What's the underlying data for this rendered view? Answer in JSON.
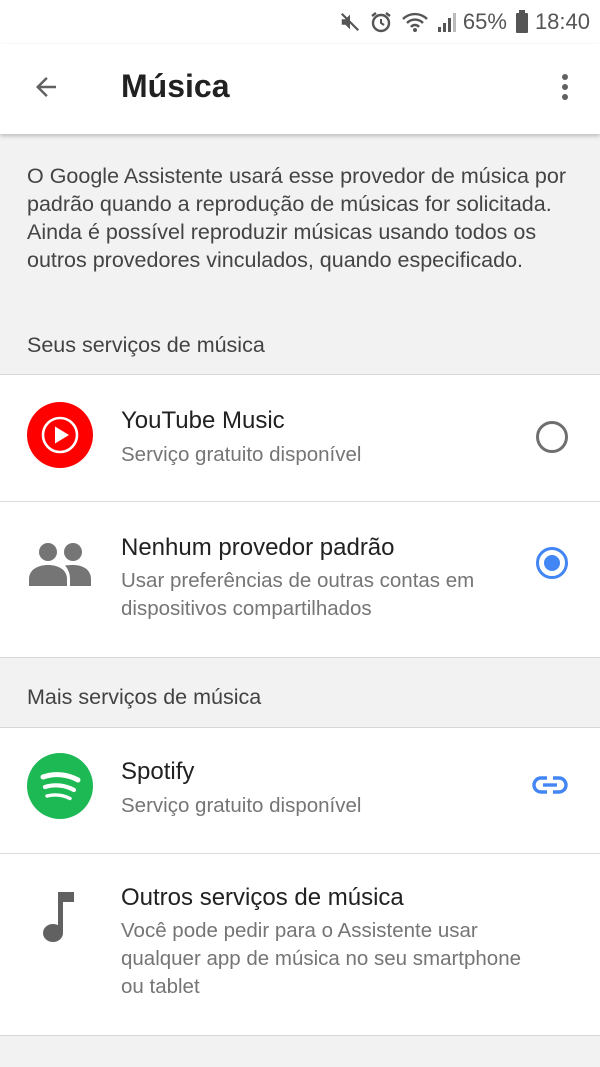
{
  "status_bar": {
    "battery": "65%",
    "time": "18:40",
    "icons": [
      "mute-icon",
      "alarm-icon",
      "wifi-icon",
      "signal-icon",
      "battery-icon"
    ]
  },
  "app_bar": {
    "title": "Música",
    "back_icon": "arrow-left-icon",
    "menu_icon": "more-vert-icon"
  },
  "description": "O Google Assistente usará esse provedor de música por padrão quando a reprodução de músicas for solicitada. Ainda é possível reproduzir músicas usando todos os outros provedores vinculados, quando especificado.",
  "sections": [
    {
      "header": "Seus serviços de música",
      "items": [
        {
          "title": "YouTube Music",
          "subtitle": "Serviço gratuito disponível",
          "icon": "youtube-music-icon",
          "action": "radio",
          "selected": false
        },
        {
          "title": "Nenhum provedor padrão",
          "subtitle": "Usar preferências de outras contas em dispositivos compartilhados",
          "icon": "people-icon",
          "action": "radio",
          "selected": true
        }
      ]
    },
    {
      "header": "Mais serviços de música",
      "items": [
        {
          "title": "Spotify",
          "subtitle": "Serviço gratuito disponível",
          "icon": "spotify-icon",
          "action": "link"
        },
        {
          "title": "Outros serviços de música",
          "subtitle": "Você pode pedir para o Assistente usar qualquer app de música no seu smartphone ou tablet",
          "icon": "music-note-icon",
          "action": "none"
        }
      ]
    }
  ],
  "colors": {
    "accent": "#4285f4",
    "youtube_red": "#ff0000",
    "spotify_green": "#1db954",
    "background": "#f2f2f2"
  }
}
